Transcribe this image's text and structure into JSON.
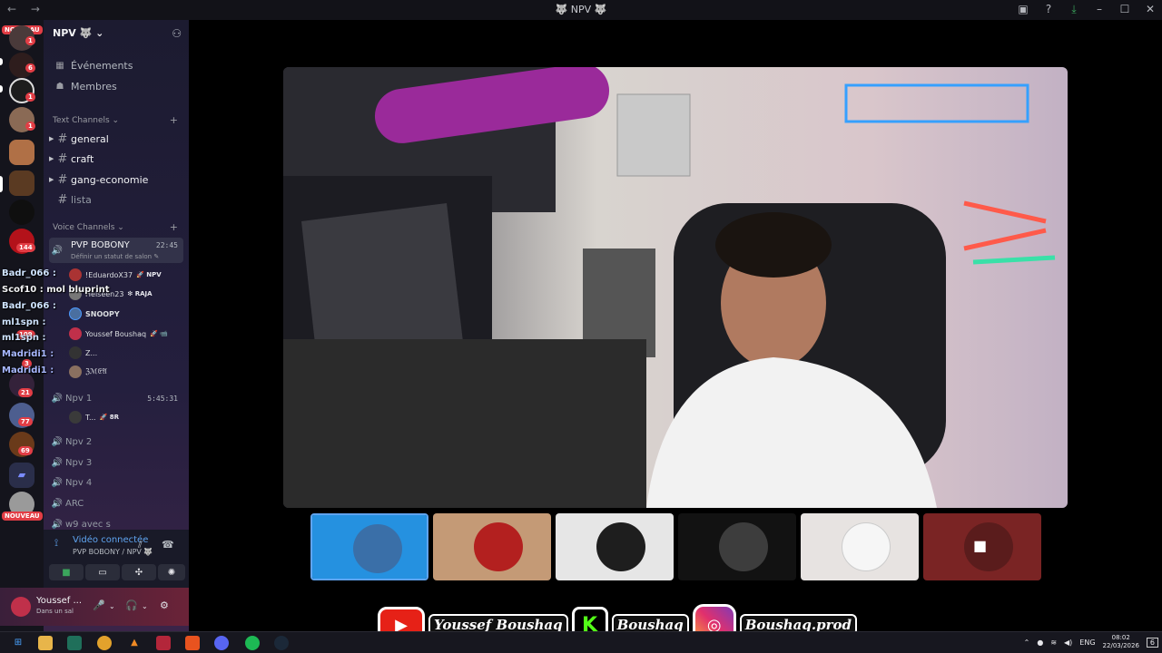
{
  "titlebar": {
    "nav": "← →",
    "title": "🐺 NPV 🐺",
    "right_icons": [
      "inbox-icon",
      "help-icon",
      "download-icon",
      "minimize-icon",
      "maximize-icon",
      "close-icon"
    ],
    "right_glyphs": [
      "▣",
      "?",
      "⤓",
      "–",
      "☐",
      "✕"
    ]
  },
  "rail": {
    "nouveau_top": "NOUVEAU",
    "nouveau_bottom": "NOUVEAU",
    "badges": [
      "1",
      "6",
      "1",
      "1",
      "144",
      "109",
      "3",
      "21",
      "77",
      "69"
    ]
  },
  "sidebar": {
    "server_name": "NPV 🐺 ⌄",
    "events": "Événements",
    "members": "Membres",
    "text_category": "Text Channels ⌄",
    "text_channels": [
      "general",
      "craft",
      "gang-economie",
      "lista"
    ],
    "voice_category": "Voice Channels ⌄",
    "active_voice": {
      "name": "PVP BOBONY",
      "time": "22:45",
      "status": "Définir un statut de salon ✎"
    },
    "voice_users": [
      {
        "name": "!EduardoX37",
        "tag": "🚀 NPV"
      },
      {
        "name": "Heiseen23",
        "tag": "❇ RAJA"
      },
      {
        "name": "SNOOPY",
        "tag": ""
      },
      {
        "name": "Youssef Boushaq",
        "tag": "🚀 📹"
      },
      {
        "name": "Z...",
        "tag": ""
      },
      {
        "name": "ℨℳ𝔈𝔄",
        "tag": ""
      }
    ],
    "npv1": {
      "name": "Npv 1",
      "time": "5:45:31",
      "user": "T...",
      "user_tag": "🚀 8R"
    },
    "other_voice": [
      "Npv 2",
      "Npv 3",
      "Npv 4",
      "ARC",
      "w9 avec s"
    ]
  },
  "chat_overlay": [
    "Badr_066 :",
    "Scof10 : mol bluprint",
    "Badr_066 :",
    "ml1spn :",
    "ml1spn :",
    "Madridi1 :",
    "Madridi1 :"
  ],
  "voice_panel": {
    "status": "Vidéo connectée",
    "channel": "PVP BOBONY / NPV 🐺",
    "buttons": [
      "camera-button",
      "screen-share-button",
      "activities-button",
      "soundboard-button"
    ],
    "button_glyphs": [
      "■",
      "▭",
      "✣",
      "✺"
    ]
  },
  "user_panel": {
    "name": "Youssef ...",
    "sub": "Dans un sal",
    "icons": [
      "🎤",
      "⌄",
      "🎧",
      "⌄",
      "⚙"
    ]
  },
  "thumbnails": [
    {
      "id": "participant-1",
      "bg": "#2591e0",
      "face": "#3a6fa8",
      "selected": true
    },
    {
      "id": "participant-2",
      "bg": "#c49a76",
      "face": "#b3201f",
      "selected": false
    },
    {
      "id": "participant-3",
      "bg": "#e6e6e6",
      "face": "#1e1e1e",
      "selected": false
    },
    {
      "id": "participant-4",
      "bg": "#121212",
      "face": "#3d3d3d",
      "selected": false
    },
    {
      "id": "participant-5",
      "bg": "#e7e3e1",
      "face": "#f6f6f6",
      "selected": false
    },
    {
      "id": "participant-6",
      "bg": "#7a2424",
      "face": "#5a1c1c",
      "selected": false
    }
  ],
  "branding": {
    "youtube": "Youssef Boushaq",
    "kick_letter": "K",
    "kick": "Boushaq",
    "instagram": "Boushaq.prod"
  },
  "taskbar": {
    "lang": "ENG",
    "time": "08:02",
    "date": "22/03/2026",
    "notif": "6"
  },
  "colors": {
    "accent": "#5fa4f0",
    "badge": "#e23d45",
    "youtube": "#e62117",
    "kick": "#53fc18"
  }
}
